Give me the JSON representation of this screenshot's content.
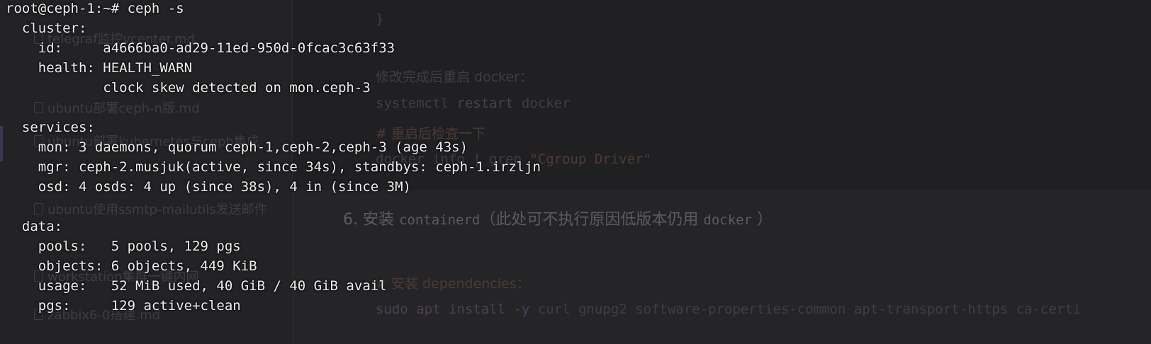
{
  "background": {
    "sidebar_files": [
      "telegraf监控vcenter.md",
      "ubuntu部署ceph-n版.md",
      "ubuntu部署kubernetes与ceph集成",
      "ubuntu使用ssmtp-mailutils发送邮件",
      "workstation集群一键内网",
      "zabbix6-0搭建.md"
    ],
    "editor": {
      "brace": "}",
      "restart_text": "修改完成后重启 docker：",
      "restart_cmd_prefix": "systemctl ",
      "restart_cmd_keyword": "restart",
      "restart_cmd_suffix": " docker",
      "check_comment": "# 重启后检查一下",
      "check_cmd_prefix": "docker info | grep ",
      "check_cmd_string": "\"Cgroup Driver\"",
      "heading_num": "6. ",
      "heading_cn1": "安装 ",
      "heading_mono1": "containerd",
      "heading_cn2": "（此处可不执行原因低版本仍用 ",
      "heading_mono2": "docker",
      "heading_cn3": " ）",
      "deps_comment": "# 安装 dependencies：",
      "install_prefix": "sudo apt install ",
      "install_flag": "-y",
      "install_suffix": " curl gnupg2 software-properties-common apt-transport-https ca-certi"
    }
  },
  "terminal": {
    "prompt": "root@ceph-1:~# ceph -s",
    "cluster_header": "  cluster:",
    "cluster_id": "    id:     a4666ba0-ad29-11ed-950d-0fcac3c63f33",
    "cluster_health": "    health: HEALTH_WARN",
    "cluster_health_detail": "            clock skew detected on mon.ceph-3",
    "services_header": "  services:",
    "service_mon": "    mon: 3 daemons, quorum ceph-1,ceph-2,ceph-3 (age 43s)",
    "service_mgr": "    mgr: ceph-2.musjuk(active, since 34s), standbys: ceph-1.irzljn",
    "service_osd": "    osd: 4 osds: 4 up (since 38s), 4 in (since 3M)",
    "data_header": "  data:",
    "data_pools": "    pools:   5 pools, 129 pgs",
    "data_objects": "    objects: 6 objects, 449 KiB",
    "data_usage": "    usage:   52 MiB used, 40 GiB / 40 GiB avail",
    "data_pgs": "    pgs:     129 active+clean"
  }
}
